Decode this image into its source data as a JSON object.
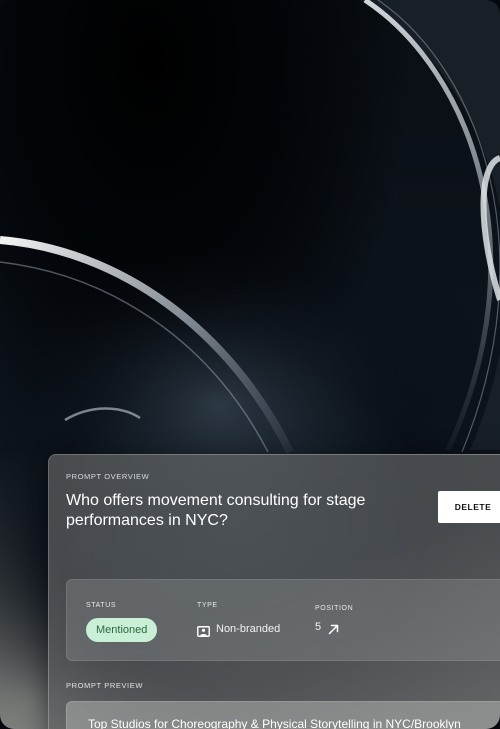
{
  "overview": {
    "label": "PROMPT OVERVIEW",
    "title": "Who offers movement consulting for stage performances in NYC?",
    "delete_label": "DELETE"
  },
  "details": {
    "status_label": "STATUS",
    "status_value": "Mentioned",
    "type_label": "TYPE",
    "type_value": "Non-branded",
    "type_icon": "image-frame-icon",
    "position_label": "POSITION",
    "position_value": "5",
    "position_icon": "arrow-up-right-icon"
  },
  "preview": {
    "label": "PROMPT PREVIEW",
    "text": "Top Studios for Choreography & Physical Storytelling in NYC/Brooklyn"
  },
  "colors": {
    "status_badge_bg": "#c9f0d6",
    "status_badge_text": "#2a6a3e",
    "button_bg": "#ffffff"
  }
}
